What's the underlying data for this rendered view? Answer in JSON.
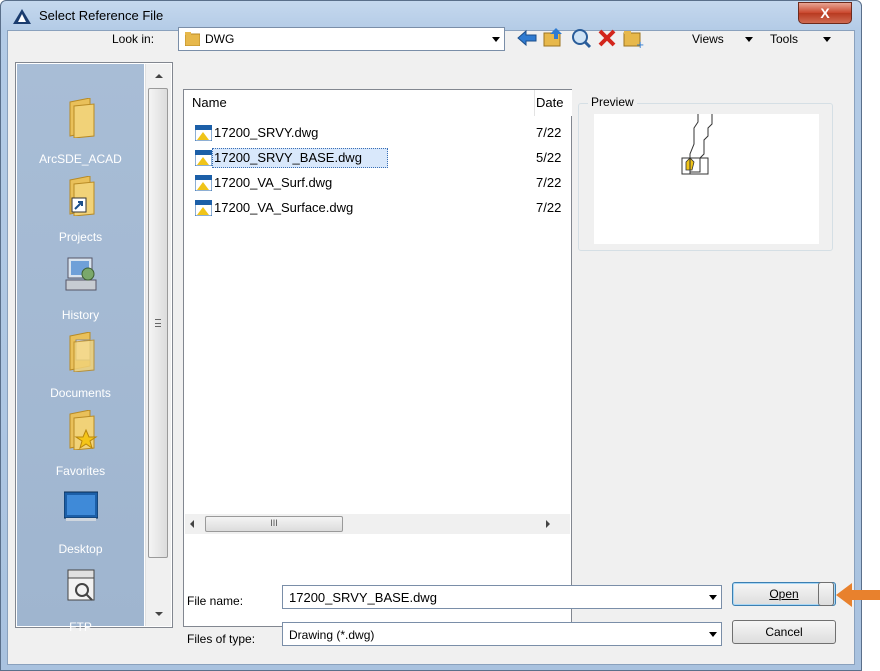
{
  "window": {
    "title": "Select Reference File",
    "close_label": "X"
  },
  "lookin": {
    "label": "Look in:",
    "value": "DWG"
  },
  "toolbar": {
    "views_label": "Views",
    "tools_label": "Tools"
  },
  "places": [
    {
      "label": "ArcSDE_ACAD",
      "icon": "folder-icon"
    },
    {
      "label": "Projects",
      "icon": "shortcut-folder-icon"
    },
    {
      "label": "History",
      "icon": "history-icon"
    },
    {
      "label": "Documents",
      "icon": "documents-icon"
    },
    {
      "label": "Favorites",
      "icon": "favorites-icon"
    },
    {
      "label": "Desktop",
      "icon": "desktop-icon"
    },
    {
      "label": "FTP",
      "icon": "ftp-icon"
    }
  ],
  "filelist": {
    "col_name": "Name",
    "col_date": "Date",
    "scroll_grip": "III",
    "files": [
      {
        "name": "17200_SRVY.dwg",
        "date": "7/22"
      },
      {
        "name": "17200_SRVY_BASE.dwg",
        "date": "5/22",
        "selected": true
      },
      {
        "name": "17200_VA_Surf.dwg",
        "date": "7/22"
      },
      {
        "name": "17200_VA_Surface.dwg",
        "date": "7/22"
      }
    ]
  },
  "preview": {
    "label": "Preview"
  },
  "filename": {
    "label": "File name:",
    "value": "17200_SRVY_BASE.dwg"
  },
  "filetype": {
    "label": "Files of type:",
    "value": "Drawing (*.dwg)"
  },
  "buttons": {
    "open": "Open",
    "cancel": "Cancel"
  },
  "colors": {
    "places_bg": "#a8bdd6",
    "selection": "#d9e8fb",
    "annotation_arrow": "#e8812d"
  }
}
